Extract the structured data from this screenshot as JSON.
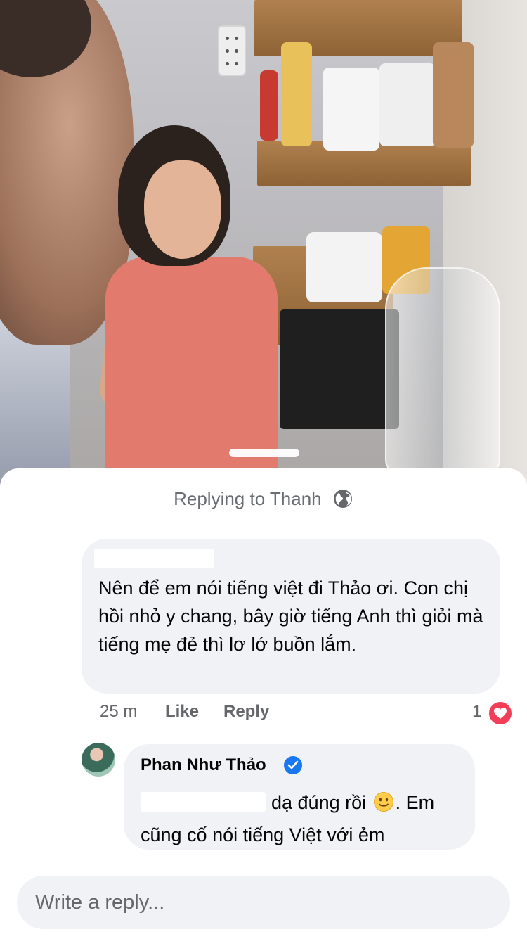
{
  "sheet": {
    "replying_label": "Replying to Thanh",
    "globe_icon": "globe-icon"
  },
  "comment": {
    "text": "Nên để em nói tiếng việt đi Thảo ơi. Con chị hồi nhỏ y chang, bây giờ tiếng Anh thì giỏi mà tiếng mẹ đẻ thì lơ lớ buồn lắm.",
    "time": "25 m",
    "like_label": "Like",
    "reply_label": "Reply",
    "reaction_count": "1",
    "reaction_icon": "heart-icon",
    "reaction_color": "#f33e58"
  },
  "reply": {
    "author": "Phan Như Thảo",
    "verified_icon": "verified-icon",
    "verified_color": "#1877f2",
    "text_part1": "dạ đúng rồi",
    "emoji_icon": "slightly-smiling-face-icon",
    "text_part2": ". Em cũng cố nói tiếng Việt với ẻm"
  },
  "composer": {
    "placeholder": "Write a reply..."
  }
}
